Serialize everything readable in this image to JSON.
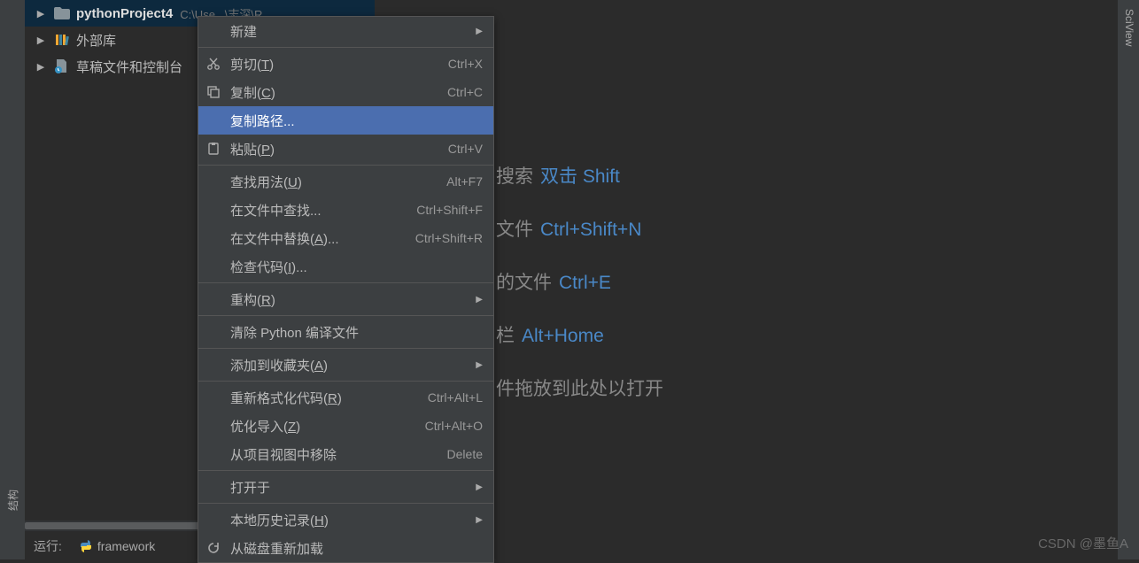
{
  "tree": {
    "project_name": "pythonProject4",
    "project_extra": "C:\\Use...\\志深\\R...",
    "external_lib": "外部库",
    "drafts": "草稿文件和控制台"
  },
  "menu": {
    "new": "新建",
    "cut": "剪切(T)",
    "cut_key": "Ctrl+X",
    "copy": "复制(C)",
    "copy_key": "Ctrl+C",
    "copy_path": "复制路径...",
    "paste": "粘贴(P)",
    "paste_key": "Ctrl+V",
    "find_usages": "查找用法(U)",
    "find_usages_key": "Alt+F7",
    "find_in_files": "在文件中查找...",
    "find_in_files_key": "Ctrl+Shift+F",
    "replace_in_files": "在文件中替换(A)...",
    "replace_in_files_key": "Ctrl+Shift+R",
    "inspect_code": "检查代码(I)...",
    "refactor": "重构(R)",
    "clean_pyc": "清除 Python 编译文件",
    "add_favorites": "添加到收藏夹(A)",
    "reformat": "重新格式化代码(R)",
    "reformat_key": "Ctrl+Alt+L",
    "optimize_imports": "优化导入(Z)",
    "optimize_imports_key": "Ctrl+Alt+O",
    "remove_from_view": "从项目视图中移除",
    "remove_key": "Delete",
    "open_in": "打开于",
    "local_history": "本地历史记录(H)",
    "reload_from_disk": "从磁盘重新加载"
  },
  "hints": {
    "search_text": "搜索",
    "search_key": "双击 Shift",
    "file_text": "文件",
    "file_key": "Ctrl+Shift+N",
    "recent_text": "的文件",
    "recent_key": "Ctrl+E",
    "nav_text": "栏",
    "nav_key": "Alt+Home",
    "drop_text": "件拖放到此处以打开"
  },
  "bottom": {
    "run": "运行:",
    "config": "framework"
  },
  "right_gutter": "SciView",
  "watermark": "CSDN @墨鱼A"
}
